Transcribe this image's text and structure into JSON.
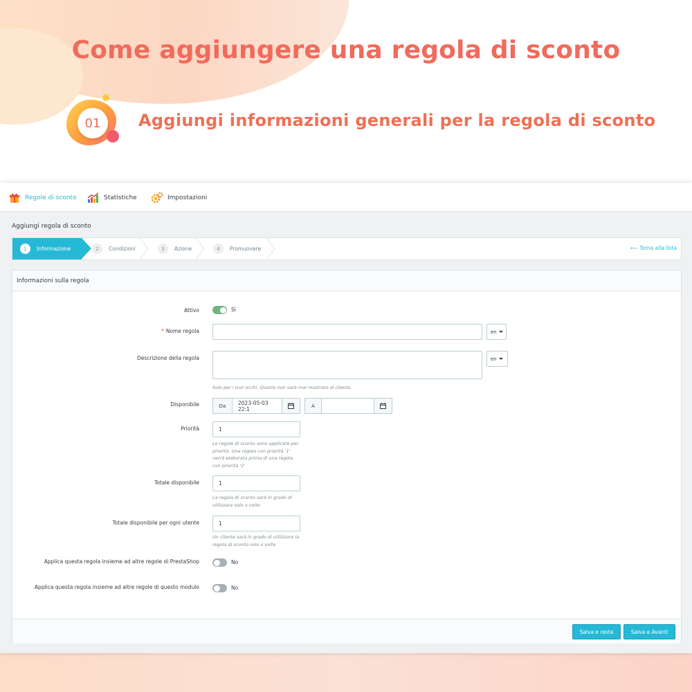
{
  "banner": {
    "title": "Come aggiungere una regola di sconto",
    "step_number": "01",
    "subtitle": "Aggiungi informazioni generali per la regola di sconto"
  },
  "nav": {
    "items": [
      {
        "label": "Regole di sconto",
        "icon": "gift-icon"
      },
      {
        "label": "Statistiche",
        "icon": "chart-icon"
      },
      {
        "label": "Impostazioni",
        "icon": "gear-icon"
      }
    ]
  },
  "page": {
    "heading": "Aggiungi regola di sconto"
  },
  "wizard": {
    "steps": [
      {
        "num": "1",
        "label": "Informazione"
      },
      {
        "num": "2",
        "label": "Condizioni"
      },
      {
        "num": "3",
        "label": "Azione"
      },
      {
        "num": "4",
        "label": "Promuovere"
      }
    ],
    "back_link": "Torna alla lista"
  },
  "form": {
    "card_title": "Informazioni sulla regola",
    "active": {
      "label": "Attivo",
      "value": "Sì"
    },
    "name": {
      "label": "Nome regola",
      "value": "",
      "lang": "en"
    },
    "description": {
      "label": "Descrizione della regola",
      "value": "",
      "lang": "en",
      "help": "Solo per i tuoi occhi. Questo non sarà mai mostrato al cliente."
    },
    "available": {
      "label": "Disponibile",
      "from_label": "Da",
      "from_value": "2023-05-03 22:1",
      "to_label": "A",
      "to_value": ""
    },
    "priority": {
      "label": "Priorità",
      "value": "1",
      "help": "Le regole di sconto sono applicate per priorità. Una regola con priorità '1' verrà elaborata prima di una regola con priorità '2'"
    },
    "total_available": {
      "label": "Totale disponibile",
      "value": "1",
      "help": "La regola di sconto sarà in grado di utilizzare solo x volte"
    },
    "total_per_user": {
      "label": "Totale disponibile per ogni utente",
      "value": "1",
      "help": "Un cliente sarà in grado di utilizzare la regola di sconto solo x volte"
    },
    "combine_prestashop": {
      "label": "Applica questa regola insieme ad altre regole di PrestaShop",
      "value": "No"
    },
    "combine_module": {
      "label": "Applica questa regola insieme ad altre regole di questo modulo",
      "value": "No"
    }
  },
  "footer": {
    "save_stay": "Salva e resta",
    "save_next": "Salva e Avanti"
  },
  "colors": {
    "accent": "#25b9d7",
    "title": "#f06b5c",
    "toggle_on": "#70b580",
    "toggle_off": "#a7b1b5"
  }
}
